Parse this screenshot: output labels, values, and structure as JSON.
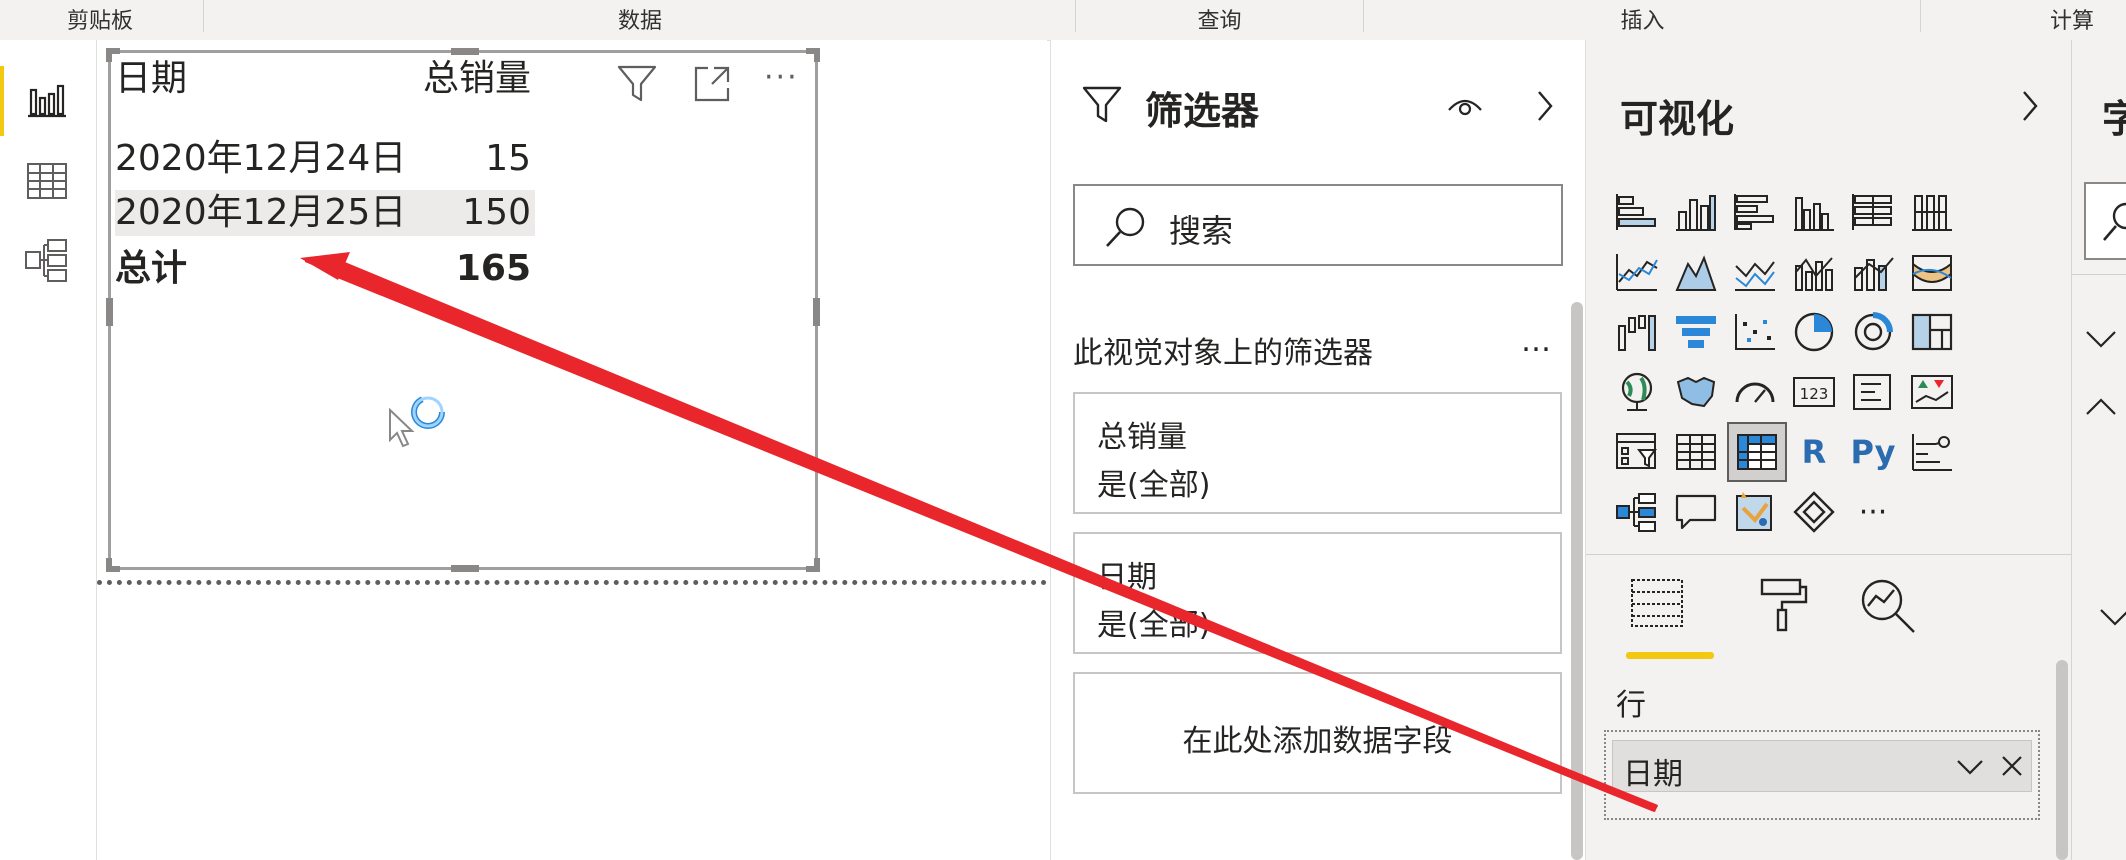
{
  "ribbon": {
    "groups": [
      "剪贴板",
      "数据",
      "查询",
      "插入",
      "计算"
    ]
  },
  "rail": {
    "items": [
      "report-view",
      "data-view",
      "model-view"
    ]
  },
  "visual": {
    "header_date": "日期",
    "header_sales": "总销量",
    "rows": [
      {
        "date": "2020年12月24日",
        "value": "15"
      },
      {
        "date": "2020年12月25日",
        "value": "150"
      }
    ],
    "total_label": "总计",
    "total_value": "165"
  },
  "filters": {
    "title": "筛选器",
    "search_placeholder": "搜索",
    "section_title": "此视觉对象上的筛选器",
    "more": "…",
    "cards": [
      {
        "field": "总销量",
        "state": "是(全部)"
      },
      {
        "field": "日期",
        "state": "是(全部)"
      }
    ],
    "add_field": "在此处添加数据字段"
  },
  "viz": {
    "title": "可视化",
    "visual_rows": [
      [
        "stacked-bar-chart-icon",
        "stacked-column-chart-icon",
        "clustered-bar-chart-icon",
        "clustered-column-chart-icon",
        "100-stacked-bar-chart-icon",
        "100-stacked-column-chart-icon"
      ],
      [
        "line-chart-icon",
        "area-chart-icon",
        "stacked-area-chart-icon",
        "line-clustered-column-chart-icon",
        "line-stacked-column-chart-icon",
        "ribbon-chart-icon"
      ],
      [
        "waterfall-chart-icon",
        "funnel-chart-icon",
        "scatter-chart-icon",
        "pie-chart-icon",
        "donut-chart-icon",
        "treemap-icon"
      ],
      [
        "map-icon",
        "filled-map-icon",
        "gauge-icon",
        "card-icon",
        "multi-row-card-icon",
        "kpi-icon"
      ],
      [
        "slicer-icon",
        "table-icon",
        "matrix-icon",
        "r-visual-icon",
        "python-visual-icon",
        "key-influencers-icon"
      ],
      [
        "decomposition-tree-icon",
        "qa-icon",
        "smart-narrative-icon",
        "power-apps-icon",
        "more-visuals-icon"
      ]
    ],
    "r_label": "R",
    "py_label": "Py",
    "more_label": "···",
    "rows_label": "行",
    "rows_field": "日期"
  },
  "fields": {
    "title_fragment": "字"
  },
  "colors": {
    "accent_yellow": "#f2c811",
    "arrow_red": "#e8262c",
    "icon_blue": "#2b88d8"
  }
}
